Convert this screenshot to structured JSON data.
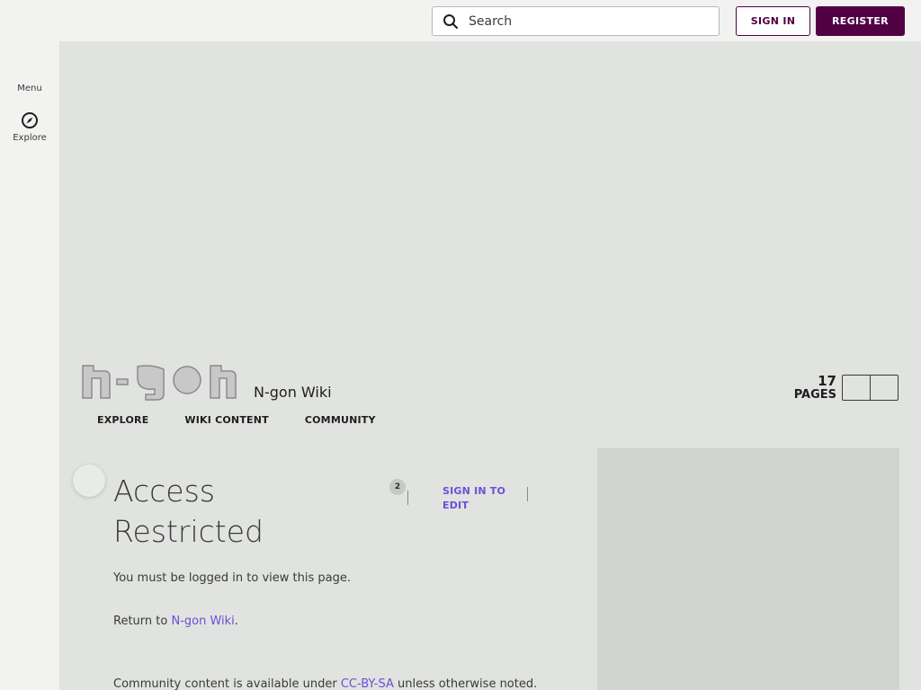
{
  "header": {
    "search_placeholder": "Search",
    "signin_label": "SIGN IN",
    "register_label": "REGISTER"
  },
  "rail": {
    "menu_label": "Menu",
    "explore_label": "Explore"
  },
  "wiki": {
    "logo_text": "n-gon",
    "name": "N-gon Wiki",
    "pages_count": "17",
    "pages_label": "PAGES",
    "nav": [
      "EXPLORE",
      "WIKI CONTENT",
      "COMMUNITY"
    ]
  },
  "article": {
    "title": "Access Restricted",
    "comment_count": "2",
    "sign_in_edit": "SIGN IN TO EDIT",
    "message": "You must be logged in to view this page.",
    "return_prefix": "Return to ",
    "return_link": "N-gon Wiki",
    "return_suffix": ".",
    "footer_prefix": "Community content is available under ",
    "footer_link": "CC-BY-SA",
    "footer_suffix": " unless otherwise noted."
  },
  "colors": {
    "brand": "#520044",
    "link": "#6a50d8",
    "page_bg": "#e0e3df"
  }
}
